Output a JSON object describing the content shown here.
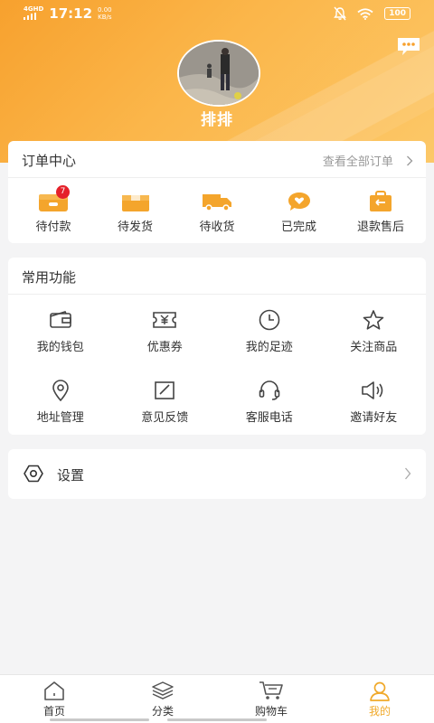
{
  "status": {
    "network": "4GHD",
    "time": "17:12",
    "speed_value": "0.00",
    "speed_unit": "KB/s",
    "battery": "100"
  },
  "profile": {
    "username": "排排"
  },
  "orders": {
    "title": "订单中心",
    "view_all": "查看全部订单",
    "items": [
      {
        "label": "待付款",
        "icon": "wallet-card-icon",
        "badge": "7"
      },
      {
        "label": "待发货",
        "icon": "package-icon"
      },
      {
        "label": "待收货",
        "icon": "truck-icon"
      },
      {
        "label": "已完成",
        "icon": "heart-chat-icon"
      },
      {
        "label": "退款售后",
        "icon": "return-bag-icon"
      }
    ]
  },
  "functions": {
    "title": "常用功能",
    "items": [
      {
        "label": "我的钱包",
        "icon": "wallet-icon"
      },
      {
        "label": "优惠券",
        "icon": "coupon-icon"
      },
      {
        "label": "我的足迹",
        "icon": "clock-icon"
      },
      {
        "label": "关注商品",
        "icon": "star-icon"
      },
      {
        "label": "地址管理",
        "icon": "location-icon"
      },
      {
        "label": "意见反馈",
        "icon": "edit-icon"
      },
      {
        "label": "客服电话",
        "icon": "headset-icon"
      },
      {
        "label": "邀请好友",
        "icon": "speaker-icon"
      }
    ]
  },
  "settings": {
    "label": "设置"
  },
  "tabbar": {
    "items": [
      {
        "label": "首页",
        "icon": "home-icon"
      },
      {
        "label": "分类",
        "icon": "layers-icon"
      },
      {
        "label": "购物车",
        "icon": "cart-icon"
      },
      {
        "label": "我的",
        "icon": "user-icon",
        "active": true
      }
    ]
  },
  "colors": {
    "accent": "#f0a92a",
    "header_gradient_start": "#f7a12e",
    "header_gradient_end": "#fcc868",
    "badge": "#e5212a"
  }
}
